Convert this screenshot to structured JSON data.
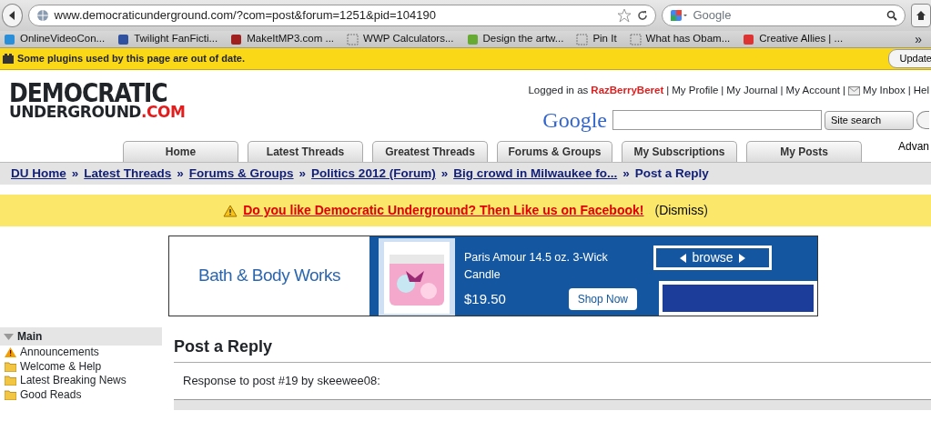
{
  "browser": {
    "url": "www.democraticunderground.com/?com=post&forum=1251&pid=104190",
    "search_placeholder": "Google",
    "bookmarks": [
      "OnlineVideoCon...",
      "Twilight FanFicti...",
      "MakeItMP3.com ...",
      "WWP Calculators...",
      "Design the artw...",
      "Pin It",
      "What has Obam...",
      "Creative Allies | ..."
    ],
    "overflow": "»",
    "notification": {
      "message": "Some plugins used by this page are out of date.",
      "button": "Update"
    }
  },
  "logo": {
    "line_1": "DEMOCRATIC",
    "line_2a": "UNDERGROUND",
    "line_2b": ".COM"
  },
  "user_bar": {
    "prefix": "Logged in as",
    "user": "RazBerryBeret",
    "links": [
      {
        "separator": "|",
        "label": "My Profile"
      },
      {
        "separator": "|",
        "label": "My Journal"
      },
      {
        "separator": "|",
        "label": "My Account"
      },
      {
        "separator": "|",
        "label": "My Inbox"
      },
      {
        "separator": "|",
        "label": "Hel"
      }
    ]
  },
  "site_search": {
    "brand": "Google",
    "scope": "Site search",
    "advanced": "Advan"
  },
  "tabs": [
    {
      "label": "Home",
      "selected": false
    },
    {
      "label": "Latest Threads",
      "selected": false
    },
    {
      "label": "Greatest Threads",
      "selected": false
    },
    {
      "label": "Forums & Groups",
      "selected": false
    },
    {
      "label": "My Subscriptions",
      "selected": false
    },
    {
      "label": "My Posts",
      "selected": false
    }
  ],
  "breadcrumb": [
    {
      "label": "DU Home",
      "link": true
    },
    {
      "separator": "»",
      "label": "Latest Threads",
      "link": true
    },
    {
      "separator": "»",
      "label": "Forums & Groups",
      "link": true
    },
    {
      "separator": "»",
      "label": "Politics 2012 (Forum)",
      "link": true
    },
    {
      "separator": "»",
      "label": "Big crowd in Milwaukee fo...",
      "link": true
    },
    {
      "separator": "»",
      "label": "Post a Reply",
      "link": false
    }
  ],
  "facebook_bar": {
    "message": "Do you like Democratic Underground? Then Like us on Facebook!",
    "dismiss_open": "(",
    "dismiss": "Dismiss",
    "dismiss_close": ")"
  },
  "ad": {
    "brand": "Bath & Body Works",
    "product": "Paris Amour 14.5 oz. 3-Wick Candle",
    "price": "$19.50",
    "button": "Shop Now",
    "browse": "browse"
  },
  "sidebar": {
    "title": "Main",
    "expanded": true,
    "items": [
      {
        "label": "Announcements",
        "kind": "alert"
      },
      {
        "label": "Welcome & Help",
        "kind": "folder"
      },
      {
        "label": "Latest Breaking News",
        "kind": "folder"
      },
      {
        "label": "Good Reads",
        "kind": "folder"
      }
    ]
  },
  "main": {
    "title": "Post a Reply",
    "subtitle": "Response to post #19 by skeewee08:"
  }
}
